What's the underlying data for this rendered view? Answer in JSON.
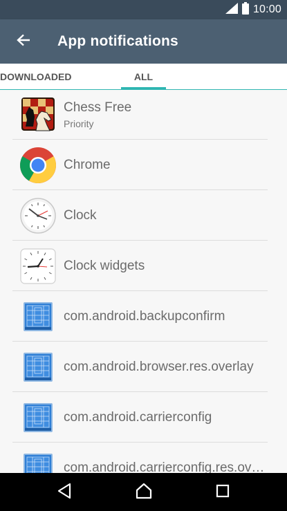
{
  "status_bar": {
    "time": "10:00",
    "icons": [
      "signal-icon",
      "battery-icon"
    ]
  },
  "app_bar": {
    "title": "App notifications",
    "back_icon": "arrow-back-icon"
  },
  "tabs": [
    {
      "label": "DOWNLOADED",
      "selected": false
    },
    {
      "label": "ALL",
      "selected": true
    }
  ],
  "apps": [
    {
      "name": "Chess Free",
      "subtitle": "Priority",
      "icon": "chess-icon"
    },
    {
      "name": "Chrome",
      "subtitle": "",
      "icon": "chrome-icon"
    },
    {
      "name": "Clock",
      "subtitle": "",
      "icon": "clock-icon"
    },
    {
      "name": "Clock widgets",
      "subtitle": "",
      "icon": "clock-widgets-icon"
    },
    {
      "name": "com.android.backupconfirm",
      "subtitle": "",
      "icon": "android-default-app-icon"
    },
    {
      "name": "com.android.browser.res.overlay",
      "subtitle": "",
      "icon": "android-default-app-icon"
    },
    {
      "name": "com.android.carrierconfig",
      "subtitle": "",
      "icon": "android-default-app-icon"
    },
    {
      "name": "com.android.carrierconfig.res.overlay",
      "subtitle": "",
      "icon": "android-default-app-icon"
    }
  ],
  "nav_bar": {
    "buttons": [
      "nav-back-icon",
      "nav-home-icon",
      "nav-recents-icon"
    ]
  },
  "colors": {
    "status_bar": "#3a4b5b",
    "app_bar": "#4c6072",
    "accent": "#2fb6b2",
    "background": "#f7f7f7"
  }
}
